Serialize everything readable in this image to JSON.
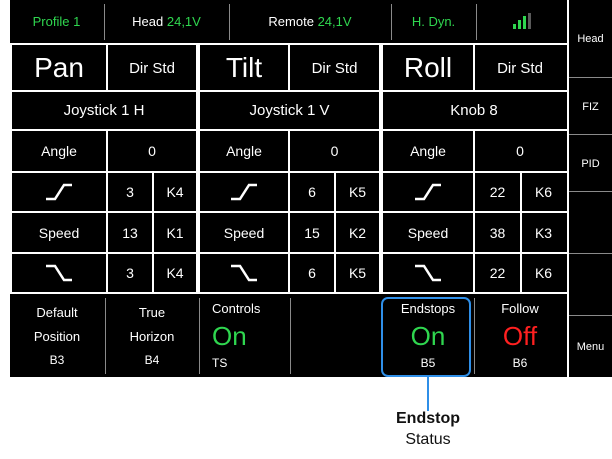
{
  "status_bar": {
    "profile": "Profile 1",
    "head_label": "Head",
    "head_voltage": "24,1V",
    "remote_label": "Remote",
    "remote_voltage": "24,1V",
    "mode": "H. Dyn.",
    "signal_icon": "signal-bars-icon"
  },
  "side_menu": [
    "Head",
    "FIZ",
    "PID",
    "",
    "",
    "Menu"
  ],
  "axes": [
    {
      "name": "Pan",
      "dir": "Dir Std",
      "input": "Joystick 1 H",
      "angle_label": "Angle",
      "angle": "0",
      "ramp_up": "3",
      "ramp_up_key": "K4",
      "speed_label": "Speed",
      "speed": "13",
      "speed_key": "K1",
      "ramp_down": "3",
      "ramp_down_key": "K4"
    },
    {
      "name": "Tilt",
      "dir": "Dir Std",
      "input": "Joystick 1 V",
      "angle_label": "Angle",
      "angle": "0",
      "ramp_up": "6",
      "ramp_up_key": "K5",
      "speed_label": "Speed",
      "speed": "15",
      "speed_key": "K2",
      "ramp_down": "6",
      "ramp_down_key": "K5"
    },
    {
      "name": "Roll",
      "dir": "Dir Std",
      "input": "Knob 8",
      "angle_label": "Angle",
      "angle": "0",
      "ramp_up": "22",
      "ramp_up_key": "K6",
      "speed_label": "Speed",
      "speed": "38",
      "speed_key": "K3",
      "ramp_down": "22",
      "ramp_down_key": "K6"
    }
  ],
  "bottom": {
    "default": {
      "line1": "Default",
      "line2": "Position",
      "key": "B3"
    },
    "true_horizon": {
      "line1": "True",
      "line2": "Horizon",
      "key": "B4"
    },
    "controls": {
      "label": "Controls",
      "value": "On",
      "key": "TS"
    },
    "endstops": {
      "label": "Endstops",
      "value": "On",
      "key": "B5"
    },
    "follow": {
      "label": "Follow",
      "value": "Off",
      "key": "B6"
    }
  },
  "callout": {
    "title": "Endstop",
    "subtitle": "Status"
  },
  "colors": {
    "background": "#000000",
    "status_green": "#2fd64f",
    "off_red": "#ff2020",
    "disabled_gray": "#6e6e6e",
    "callout_blue": "#2f8fe8"
  }
}
